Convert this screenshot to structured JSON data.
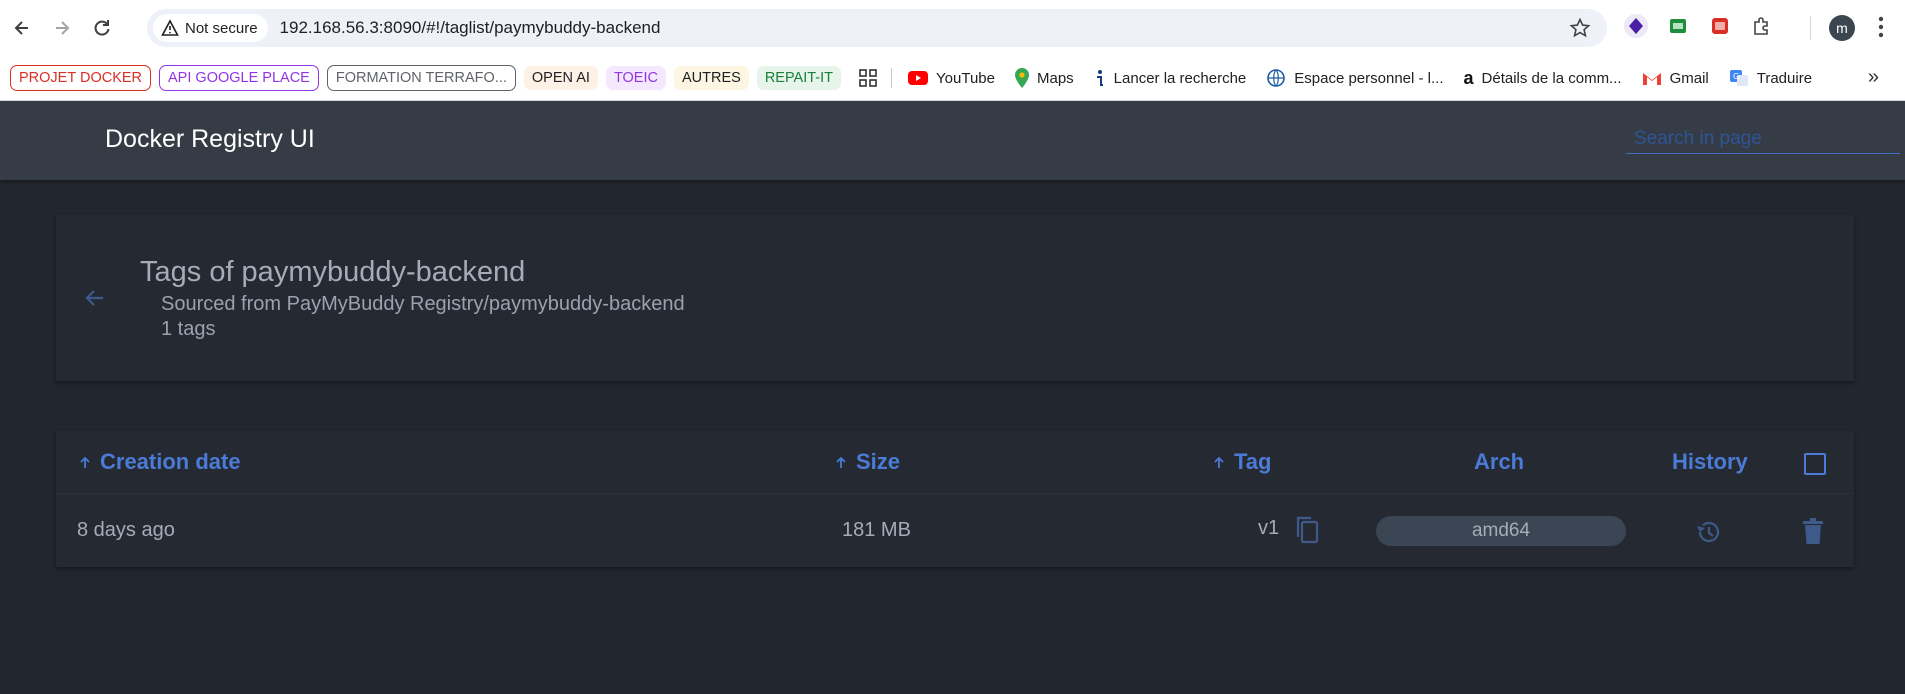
{
  "browser": {
    "security_label": "Not secure",
    "url": "192.168.56.3:8090/#!/taglist/paymybuddy-backend",
    "profile_initial": "m"
  },
  "bookmarks": {
    "tags": [
      {
        "label": "PROJET DOCKER",
        "color": "#d93025"
      },
      {
        "label": "API GOOGLE PLACE",
        "color": "#9334e6"
      },
      {
        "label": "FORMATION TERRAFO...",
        "color": "#5f6368"
      },
      {
        "label": "OPEN AI",
        "color": "#202124"
      },
      {
        "label": "TOEIC",
        "color": "#9334e6"
      },
      {
        "label": "AUTRES",
        "color": "#202124"
      },
      {
        "label": "REPAIT-IT",
        "color": "#188038"
      }
    ],
    "links": [
      {
        "label": "YouTube",
        "icon": "youtube-icon"
      },
      {
        "label": "Maps",
        "icon": "maps-icon"
      },
      {
        "label": "Lancer la recherche",
        "icon": "info-icon"
      },
      {
        "label": "Espace personnel - l...",
        "icon": "globe-icon"
      },
      {
        "label": "Détails de la comm...",
        "icon": "amazon-icon"
      },
      {
        "label": "Gmail",
        "icon": "gmail-icon"
      },
      {
        "label": "Traduire",
        "icon": "translate-icon"
      }
    ]
  },
  "app": {
    "title": "Docker Registry UI",
    "search_placeholder": "Search in page"
  },
  "tags_card": {
    "title": "Tags of paymybuddy-backend",
    "source": "Sourced from PayMyBuddy Registry/paymybuddy-backend",
    "count": "1 tags"
  },
  "table": {
    "headers": {
      "creation_date": "Creation date",
      "size": "Size",
      "tag": "Tag",
      "arch": "Arch",
      "history": "History"
    },
    "rows": [
      {
        "created": "8 days ago",
        "size": "181 MB",
        "tag": "v1",
        "arch": "amd64"
      }
    ]
  },
  "colors": {
    "accent": "#4b7bd6",
    "header_bg": "#363c46",
    "page_bg": "#22262e"
  }
}
